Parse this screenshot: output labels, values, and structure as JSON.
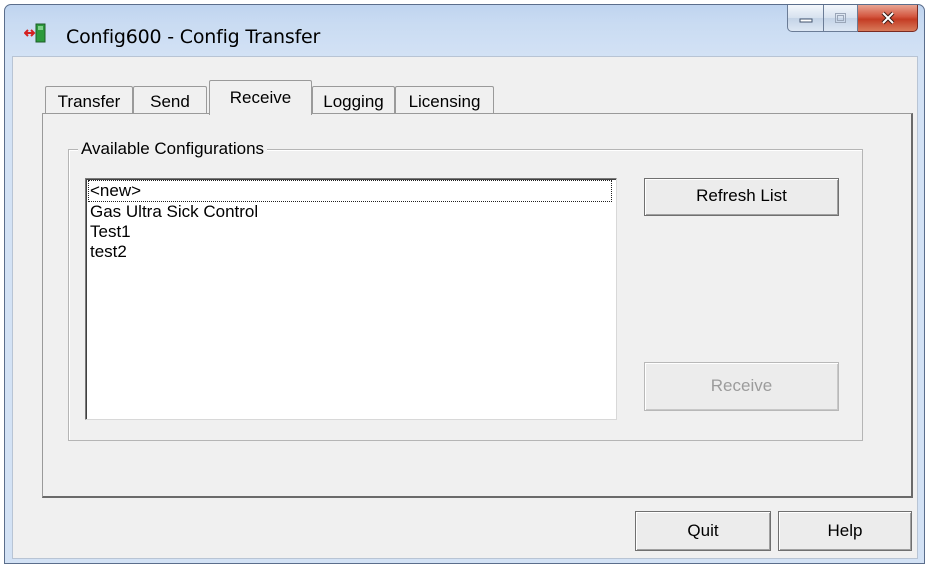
{
  "window": {
    "title": "Config600 - Config Transfer",
    "icon": "transfer-arrows-icon"
  },
  "caption_buttons": {
    "minimize_icon": "minimize-icon",
    "maximize_icon": "maximize-icon",
    "close_icon": "close-icon"
  },
  "tabs": [
    {
      "label": "Transfer",
      "active": false
    },
    {
      "label": "Send",
      "active": false
    },
    {
      "label": "Receive",
      "active": true
    },
    {
      "label": "Logging",
      "active": false
    },
    {
      "label": "Licensing",
      "active": false
    }
  ],
  "receive_panel": {
    "group_label": "Available Configurations",
    "configurations": [
      "<new>",
      "Gas Ultra Sick Control",
      "Test1",
      "test2"
    ],
    "refresh_label": "Refresh List",
    "receive_label": "Receive"
  },
  "footer": {
    "quit_label": "Quit",
    "help_label": "Help"
  },
  "colors": {
    "title_bar": "#c9dbf2",
    "close_button": "#c43c24",
    "client_bg": "#f0f0f0",
    "disabled_text": "#9c9c9c"
  }
}
